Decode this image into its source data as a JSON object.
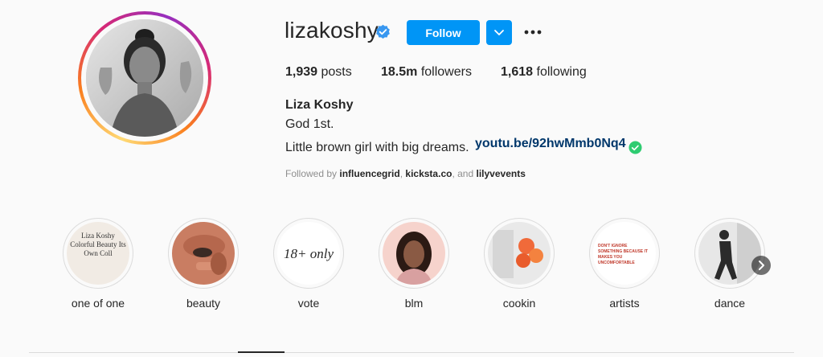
{
  "profile": {
    "username": "lizakoshy",
    "follow_label": "Follow",
    "stats": {
      "posts_count": "1,939",
      "posts_label": "posts",
      "followers_count": "18.5m",
      "followers_label": "followers",
      "following_count": "1,618",
      "following_label": "following"
    },
    "full_name": "Liza Koshy",
    "bio_line1": "God 1st.",
    "bio_line2": "Little brown girl with big dreams.",
    "bio_link": "youtu.be/92hwMmb0Nq4",
    "followed_by_prefix": "Followed by",
    "followed_by_1": "influencegrid",
    "followed_by_sep1": ",",
    "followed_by_2": "kicksta.co",
    "followed_by_sep2": ", and",
    "followed_by_3": "lilyvevents"
  },
  "highlights": [
    {
      "label": "one of one",
      "cover_text": "Liza Koshy Colorful Beauty Its Own Coll"
    },
    {
      "label": "beauty"
    },
    {
      "label": "vote",
      "cover_text": "18+ only"
    },
    {
      "label": "blm"
    },
    {
      "label": "cookin"
    },
    {
      "label": "artists",
      "cover_text": "DON'T IGNORE SOMETHING BECAUSE IT MAKES YOU UNCOMFORTABLE"
    },
    {
      "label": "dance"
    }
  ],
  "colors": {
    "accent": "#0095f6",
    "link": "#00376b",
    "verified": "#3897f0",
    "check": "#2ecc71"
  }
}
